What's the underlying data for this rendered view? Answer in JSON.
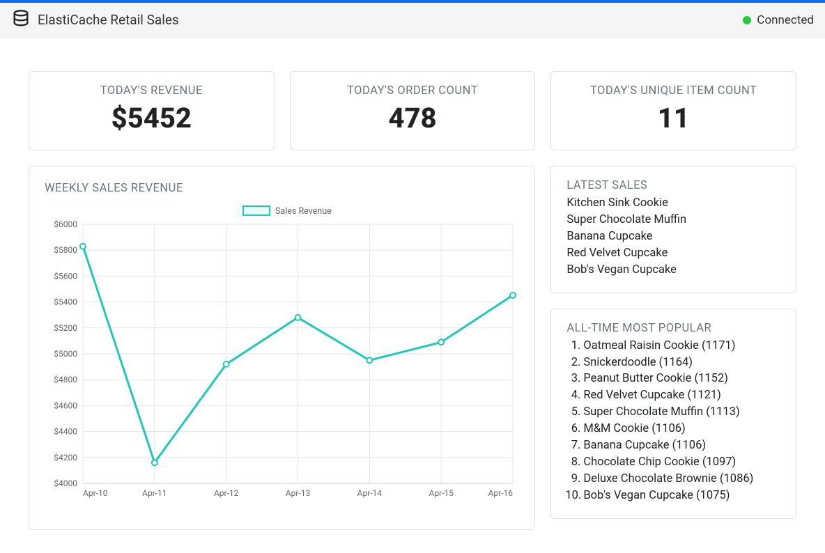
{
  "header": {
    "title": "ElastiCache Retail Sales",
    "status_text": "Connected",
    "status_color": "#28c840"
  },
  "stats": {
    "revenue_label": "TODAY'S REVENUE",
    "revenue_value": "$5452",
    "orders_label": "TODAY'S ORDER COUNT",
    "orders_value": "478",
    "items_label": "TODAY'S UNIQUE ITEM COUNT",
    "items_value": "11"
  },
  "chart_title": "WEEKLY SALES REVENUE",
  "chart_legend": "Sales Revenue",
  "y_ticks": [
    "$6000",
    "$5800",
    "$5600",
    "$5400",
    "$5200",
    "$5000",
    "$4800",
    "$4600",
    "$4400",
    "$4200",
    "$4000"
  ],
  "x_ticks": [
    "Apr-10",
    "Apr-11",
    "Apr-12",
    "Apr-13",
    "Apr-14",
    "Apr-15",
    "Apr-16"
  ],
  "latest_title": "LATEST SALES",
  "latest_items": [
    "Kitchen Sink Cookie",
    "Super Chocolate Muffin",
    "Banana Cupcake",
    "Red Velvet Cupcake",
    "Bob's Vegan Cupcake"
  ],
  "popular_title": "ALL-TIME MOST POPULAR",
  "popular_items": [
    "Oatmeal Raisin Cookie (1171)",
    "Snickerdoodle (1164)",
    "Peanut Butter Cookie (1152)",
    "Red Velvet Cupcake (1121)",
    "Super Chocolate Muffin (1113)",
    "M&M Cookie (1106)",
    "Banana Cupcake (1106)",
    "Chocolate Chip Cookie (1097)",
    "Deluxe Chocolate Brownie (1086)",
    "Bob's Vegan Cupcake (1075)"
  ],
  "chart_data": {
    "type": "line",
    "title": "WEEKLY SALES REVENUE",
    "xlabel": "",
    "ylabel": "",
    "ylim": [
      4000,
      6000
    ],
    "categories": [
      "Apr-10",
      "Apr-11",
      "Apr-12",
      "Apr-13",
      "Apr-14",
      "Apr-15",
      "Apr-16"
    ],
    "series": [
      {
        "name": "Sales Revenue",
        "values": [
          5830,
          4160,
          4920,
          5280,
          4950,
          5090,
          5452
        ]
      }
    ],
    "legend_position": "top",
    "grid": true,
    "accent": "#1fc8ba"
  }
}
